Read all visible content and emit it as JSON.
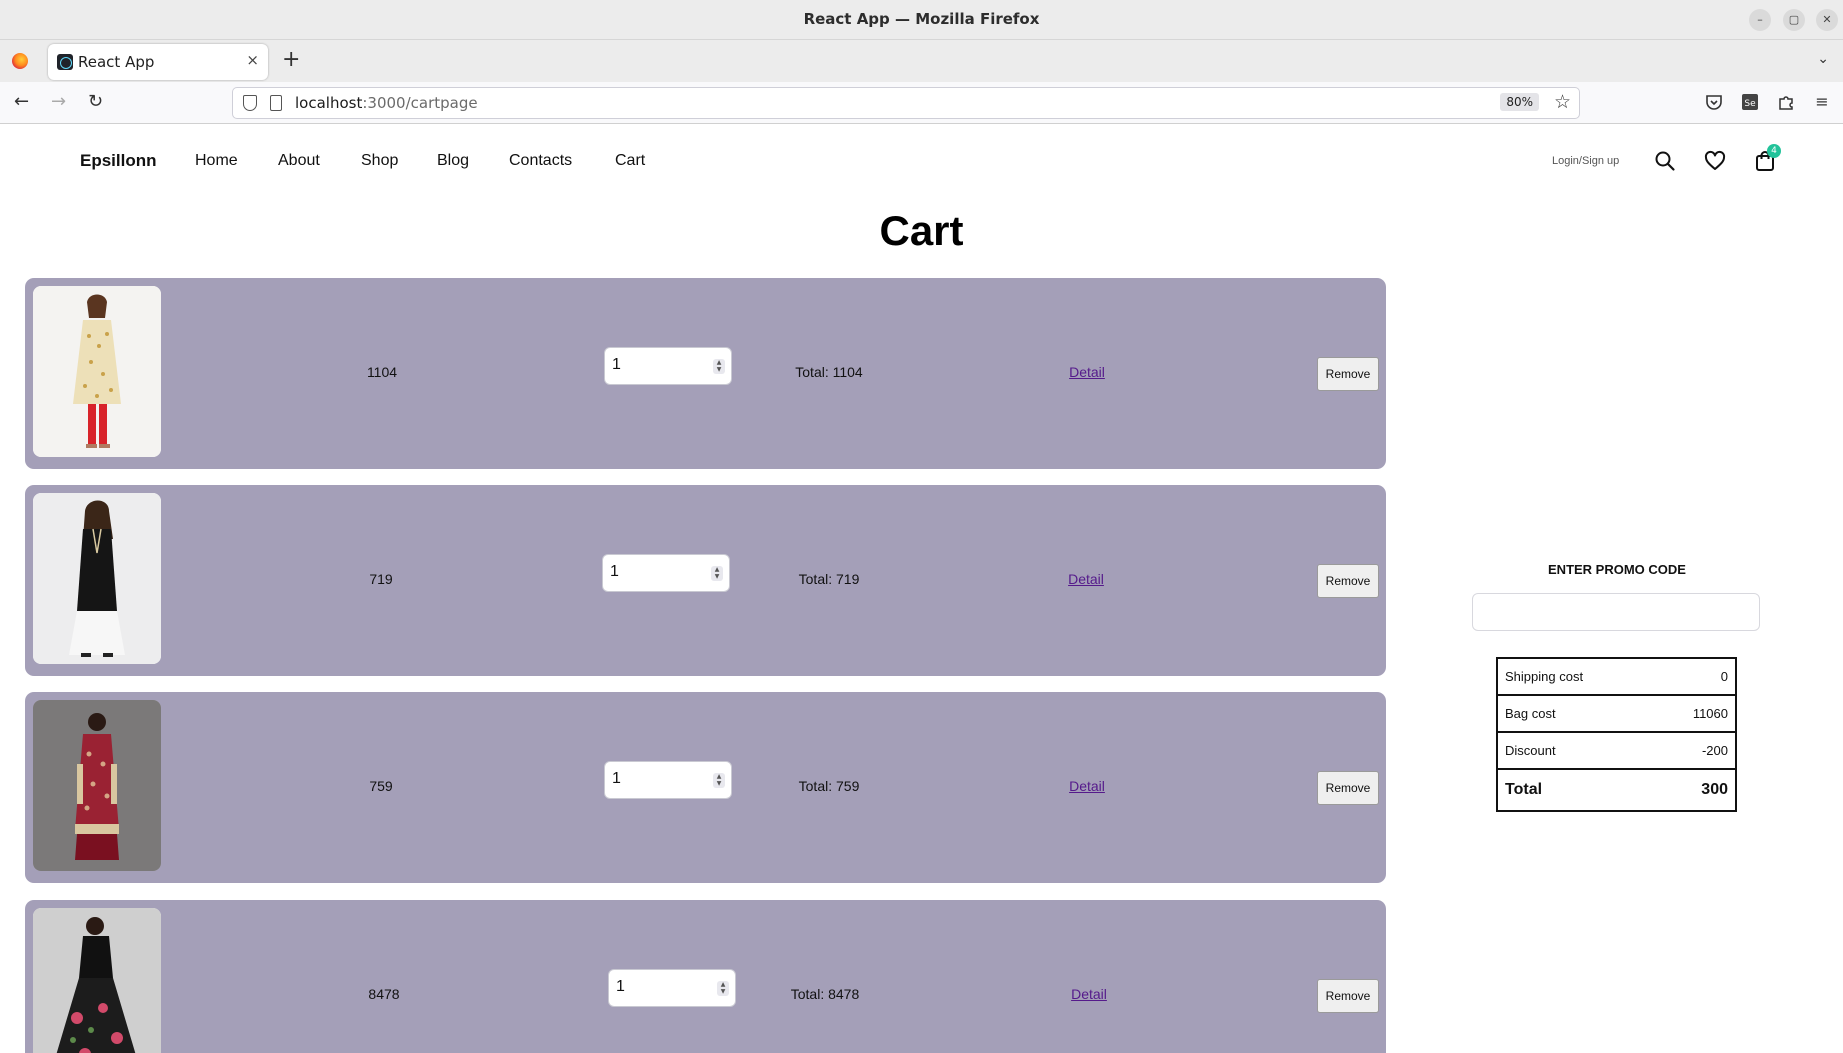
{
  "window": {
    "title": "React App — Mozilla Firefox",
    "controls": {
      "minimize": "–",
      "restore": "▢",
      "close": "✕"
    }
  },
  "tabs": [
    {
      "label": "React App",
      "close": "×"
    }
  ],
  "toolbar": {
    "new_tab": "+",
    "tab_list": "⌄",
    "back": "←",
    "forward": "→",
    "reload": "↻",
    "url_host": "localhost",
    "url_rest": ":3000/cartpage",
    "zoom": "80%",
    "bookmark": "☆",
    "menu": "≡"
  },
  "site": {
    "logo": "Epsillonn",
    "nav": [
      "Home",
      "About",
      "Shop",
      "Blog",
      "Contacts",
      "Cart"
    ],
    "login": "Login/Sign up",
    "cart_count": "4"
  },
  "page_title": "Cart",
  "cart_items": [
    {
      "price": "1104",
      "qty": "1",
      "total": "Total: 1104",
      "detail": "Detail",
      "remove": "Remove",
      "image": "woman in cream printed kurta with red leggings"
    },
    {
      "price": "719",
      "qty": "1",
      "total": "Total: 719",
      "detail": "Detail",
      "remove": "Remove",
      "image": "woman in black kurta with white palazzo"
    },
    {
      "price": "759",
      "qty": "1",
      "total": "Total: 759",
      "detail": "Detail",
      "remove": "Remove",
      "image": "woman in maroon printed anarkali"
    },
    {
      "price": "8478",
      "qty": "1",
      "total": "Total: 8478",
      "detail": "Detail",
      "remove": "Remove",
      "image": "woman in black floral lehenga"
    }
  ],
  "summary": {
    "promo_label": "ENTER PROMO CODE",
    "promo_value": "",
    "rows": [
      {
        "label": "Shipping cost",
        "value": "0"
      },
      {
        "label": "Bag cost",
        "value": "11060"
      },
      {
        "label": "Discount",
        "value": "-200"
      },
      {
        "label": "Total",
        "value": "300"
      }
    ]
  },
  "colors": {
    "row_bg": "#a49fb8",
    "badge": "#22c39a",
    "link": "#551a8b"
  }
}
